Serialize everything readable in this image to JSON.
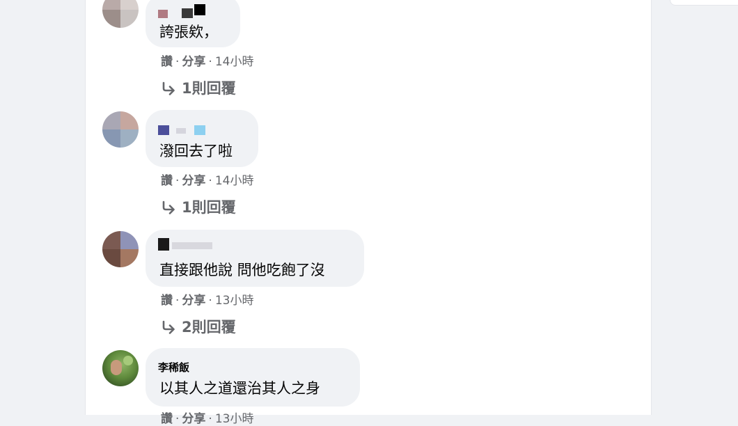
{
  "comments": [
    {
      "author": "",
      "text": "誇張欸，",
      "like_label": "讚",
      "share_label": "分享",
      "time": "14小時",
      "replies_label": "1則回覆"
    },
    {
      "author": "",
      "text": "潑回去了啦",
      "like_label": "讚",
      "share_label": "分享",
      "time": "14小時",
      "replies_label": "1則回覆"
    },
    {
      "author": "",
      "text": "直接跟他說 問他吃飽了沒",
      "like_label": "讚",
      "share_label": "分享",
      "time": "13小時",
      "replies_label": "2則回覆"
    },
    {
      "author": "李稀飯",
      "text": "以其人之道還治其人之身",
      "like_label": "讚",
      "share_label": "分享",
      "time": "13小時"
    }
  ],
  "separator": "·",
  "icons": {
    "reply": "reply-arrow-icon"
  },
  "colors": {
    "page_background": "#f0f2f5",
    "bubble_background": "#f0f2f5",
    "secondary_text": "#65676b",
    "primary_text": "#050505"
  }
}
